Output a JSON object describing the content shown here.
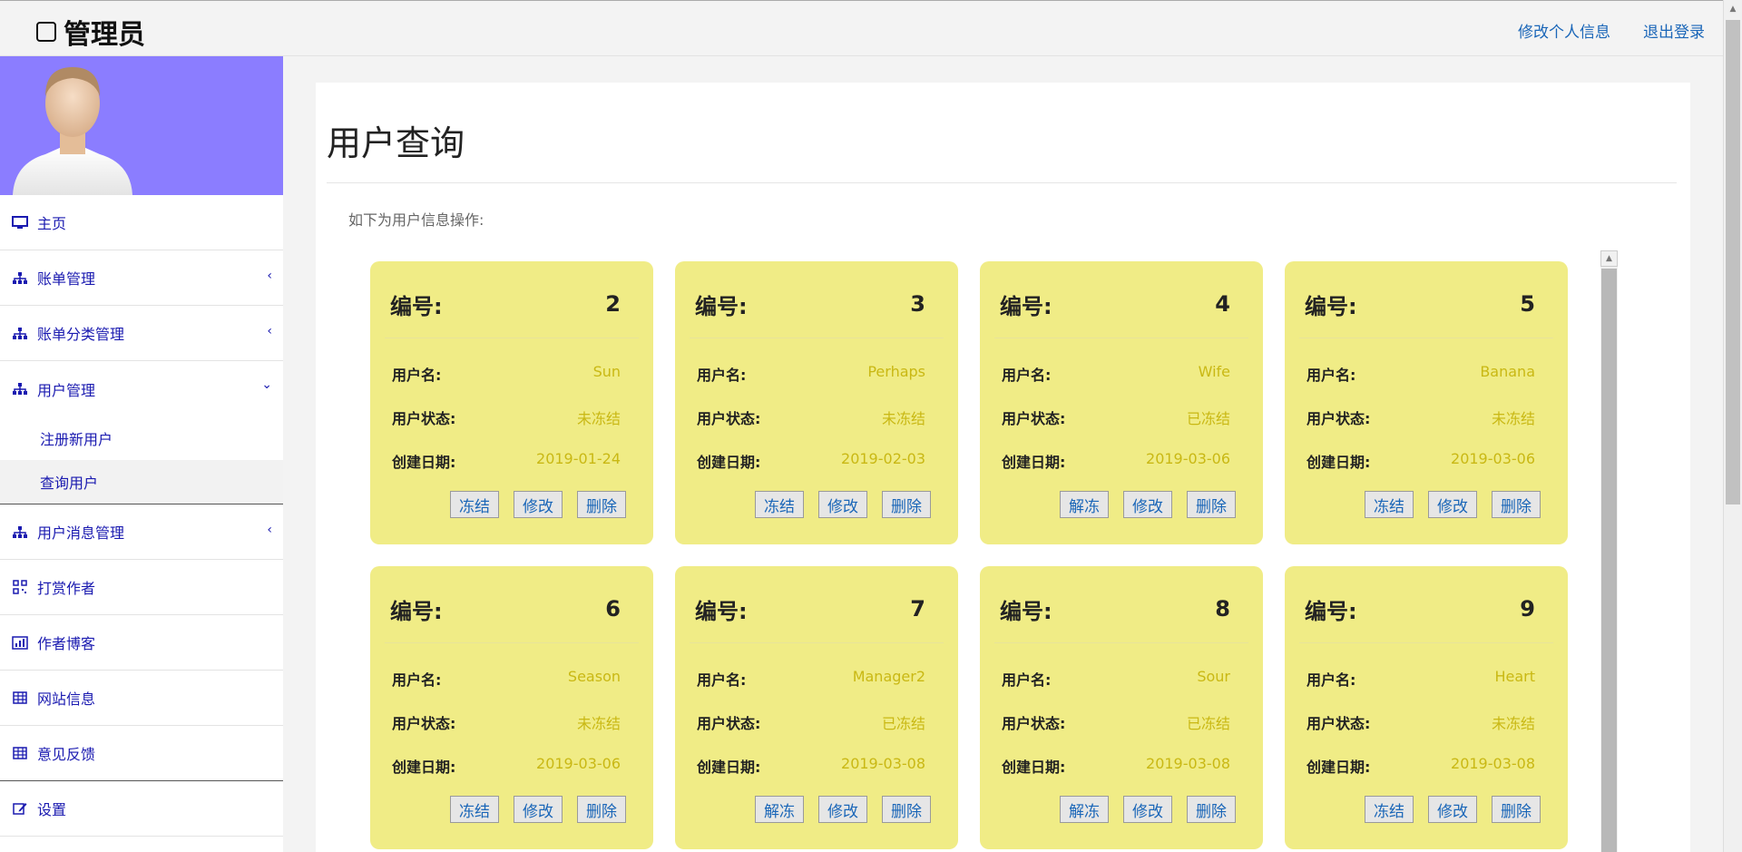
{
  "header": {
    "title": "管理员",
    "links": [
      "修改个人信息",
      "退出登录"
    ]
  },
  "sidebar": {
    "items": [
      {
        "label": "主页",
        "icon": "monitor-icon"
      },
      {
        "label": "账单管理",
        "icon": "sitemap-icon",
        "chevron": "left"
      },
      {
        "label": "账单分类管理",
        "icon": "sitemap-icon",
        "chevron": "left"
      },
      {
        "label": "用户管理",
        "icon": "sitemap-icon",
        "chevron": "down"
      },
      {
        "label": "用户消息管理",
        "icon": "sitemap-icon",
        "chevron": "left"
      },
      {
        "label": "打赏作者",
        "icon": "qrcode-icon"
      },
      {
        "label": "作者博客",
        "icon": "bar-chart-icon"
      },
      {
        "label": "网站信息",
        "icon": "table-icon"
      },
      {
        "label": "意见反馈",
        "icon": "table-icon"
      },
      {
        "label": "设置",
        "icon": "edit-icon"
      }
    ],
    "sub_items": [
      "注册新用户",
      "查询用户"
    ]
  },
  "main": {
    "title": "用户查询",
    "intro": "如下为用户信息操作:",
    "labels": {
      "id": "编号:",
      "username": "用户名:",
      "status": "用户状态:",
      "created": "创建日期:"
    },
    "buttons": {
      "edit": "修改",
      "delete": "删除"
    },
    "users": [
      {
        "id": "2",
        "username": "Sun",
        "status": "未冻结",
        "created": "2019-01-24",
        "action": "冻结"
      },
      {
        "id": "3",
        "username": "Perhaps",
        "status": "未冻结",
        "created": "2019-02-03",
        "action": "冻结"
      },
      {
        "id": "4",
        "username": "Wife",
        "status": "已冻结",
        "created": "2019-03-06",
        "action": "解冻"
      },
      {
        "id": "5",
        "username": "Banana",
        "status": "未冻结",
        "created": "2019-03-06",
        "action": "冻结"
      },
      {
        "id": "6",
        "username": "Season",
        "status": "未冻结",
        "created": "2019-03-06",
        "action": "冻结"
      },
      {
        "id": "7",
        "username": "Manager2",
        "status": "已冻结",
        "created": "2019-03-08",
        "action": "解冻"
      },
      {
        "id": "8",
        "username": "Sour",
        "status": "已冻结",
        "created": "2019-03-08",
        "action": "解冻"
      },
      {
        "id": "9",
        "username": "Heart",
        "status": "未冻结",
        "created": "2019-03-08",
        "action": "冻结"
      }
    ]
  },
  "colors": {
    "card_bg": "#f0ec86",
    "card_value": "#c9b814",
    "sidebar_avatar_bg": "#8b7dff",
    "link": "#1a66b8",
    "menu_text": "#1a1ab0"
  }
}
